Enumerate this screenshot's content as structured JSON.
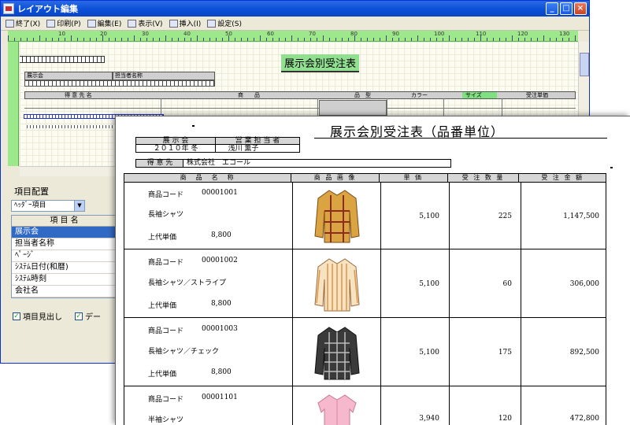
{
  "window": {
    "title": "レイアウト編集",
    "buttons": {
      "minimize": "_",
      "maximize": "□",
      "close": "×"
    }
  },
  "menu": [
    {
      "label": "終了(X)",
      "icon": "exit-icon"
    },
    {
      "label": "印刷(P)",
      "icon": "print-icon"
    },
    {
      "label": "編集(E)",
      "icon": "edit-icon"
    },
    {
      "label": "表示(V)",
      "icon": "view-icon"
    },
    {
      "label": "挿入(I)",
      "icon": "insert-icon"
    },
    {
      "label": "設定(S)",
      "icon": "settings-icon"
    }
  ],
  "ruler": {
    "marks": [
      "10",
      "20",
      "30",
      "40",
      "50",
      "60",
      "70",
      "80",
      "90",
      "100",
      "110",
      "120",
      "130"
    ]
  },
  "design": {
    "title": "展示会別受注表",
    "fields": {
      "exhibition": "展示会",
      "staff": "担当者名称",
      "color": "カラー",
      "size": "サイズ",
      "order_price": "受注単価"
    },
    "header_cols": {
      "customer": "得 意 先 名",
      "product": "商　　品",
      "model": "品　型",
      "color": "カラー",
      "size": "サイズ",
      "price": "受注単価"
    },
    "row_marker": "ㅁ"
  },
  "panel": {
    "title": "項目配置",
    "combo_value": "ﾍｯﾀﾞｰ項目",
    "combo_arrow": "▼",
    "list_header": "項 目 名",
    "items": [
      {
        "label": "展示会",
        "selected": true
      },
      {
        "label": "担当者名称",
        "selected": false
      },
      {
        "label": "ﾍﾟｰｼﾞ",
        "selected": false
      },
      {
        "label": "ｼｽﾃﾑ日付(和暦)",
        "selected": false
      },
      {
        "label": "ｼｽﾃﾑ時刻",
        "selected": false
      },
      {
        "label": "会社名",
        "selected": false
      }
    ],
    "checks": [
      {
        "label": "項目見出し",
        "checked": true
      },
      {
        "label": "デー",
        "checked": true
      }
    ],
    "check_mark": "✓"
  },
  "report": {
    "title": "展示会別受注表（品番単位）",
    "info": {
      "exhibition_label": "展 示 会",
      "staff_label": "営 業 担 当 者",
      "exhibition_value": "２０１０年 冬",
      "staff_value": "浅川 薫子",
      "customer_label": "得 意 先",
      "customer_value": "株式会社　エコール"
    },
    "columns": [
      "商　品　名　称",
      "商 品 画 像",
      "単 価",
      "受 注 数 量",
      "受 注 金 額"
    ],
    "rows": [
      {
        "code_label": "商品コード",
        "code": "00001001",
        "name": "長袖シャツ",
        "retail_label": "上代単価",
        "retail": "8,800",
        "unit_price": "5,100",
        "qty": "225",
        "amount": "1,147,500",
        "shirt": "shirt-plaid-icon"
      },
      {
        "code_label": "商品コード",
        "code": "00001002",
        "name": "長袖シャツ／ストライプ",
        "retail_label": "上代単価",
        "retail": "8,800",
        "unit_price": "5,100",
        "qty": "60",
        "amount": "306,000",
        "shirt": "shirt-stripe-icon"
      },
      {
        "code_label": "商品コード",
        "code": "00001003",
        "name": "長袖シャツ／チェック",
        "retail_label": "上代単価",
        "retail": "8,800",
        "unit_price": "5,100",
        "qty": "175",
        "amount": "892,500",
        "shirt": "shirt-check-icon"
      },
      {
        "code_label": "商品コード",
        "code": "00001101",
        "name": "半袖シャツ",
        "retail_label": "",
        "retail": "",
        "unit_price": "3,940",
        "qty": "120",
        "amount": "472,800",
        "shirt": "shirt-pink-icon"
      }
    ]
  }
}
